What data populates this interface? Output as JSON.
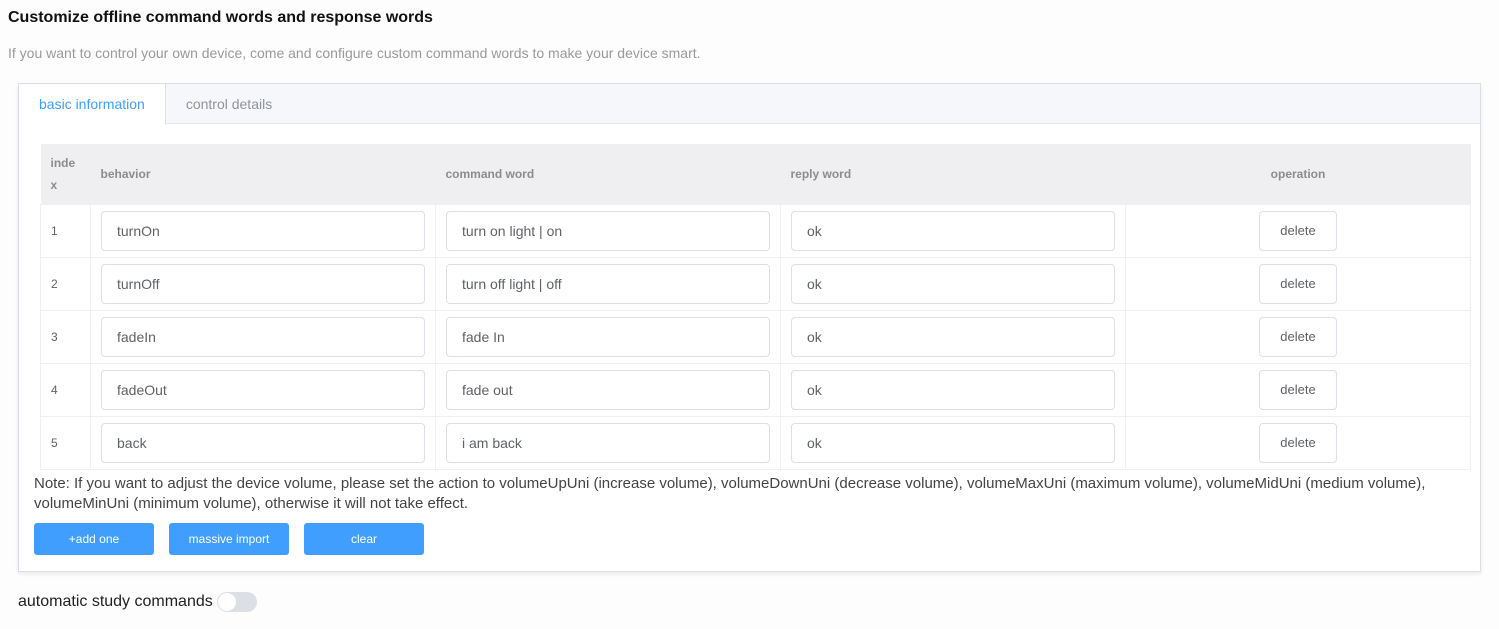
{
  "header": {
    "title": "Customize offline command words and response words",
    "subtitle": "If you want to control your own device, come and configure custom command words to make your device smart."
  },
  "tabs": [
    {
      "label": "basic information",
      "active": true
    },
    {
      "label": "control details",
      "active": false
    }
  ],
  "table": {
    "columns": {
      "index": "inde x",
      "behavior": "behavior",
      "command_word": "command word",
      "reply_word": "reply word",
      "operation": "operation"
    },
    "rows": [
      {
        "index": "1",
        "behavior": "turnOn",
        "command_word": "turn on light | on",
        "reply_word": "ok",
        "action": "delete"
      },
      {
        "index": "2",
        "behavior": "turnOff",
        "command_word": "turn off light | off",
        "reply_word": "ok",
        "action": "delete"
      },
      {
        "index": "3",
        "behavior": "fadeIn",
        "command_word": "fade In",
        "reply_word": "ok",
        "action": "delete"
      },
      {
        "index": "4",
        "behavior": "fadeOut",
        "command_word": "fade out",
        "reply_word": "ok",
        "action": "delete"
      },
      {
        "index": "5",
        "behavior": "back",
        "command_word": "i am back",
        "reply_word": "ok",
        "action": "delete"
      }
    ]
  },
  "note": "Note: If you want to adjust the device volume, please set the action to volumeUpUni (increase volume), volumeDownUni (decrease volume), volumeMaxUni (maximum volume), volumeMidUni (medium volume), volumeMinUni (minimum volume), otherwise it will not take effect.",
  "buttons": {
    "add_one": "+add one",
    "massive_import": "massive import",
    "clear": "clear"
  },
  "auto_study": {
    "label": "automatic study commands",
    "enabled": false
  },
  "colors": {
    "primary": "#409eff",
    "active_tab_text": "#409eff",
    "switch_off": "#dcdfe6"
  }
}
